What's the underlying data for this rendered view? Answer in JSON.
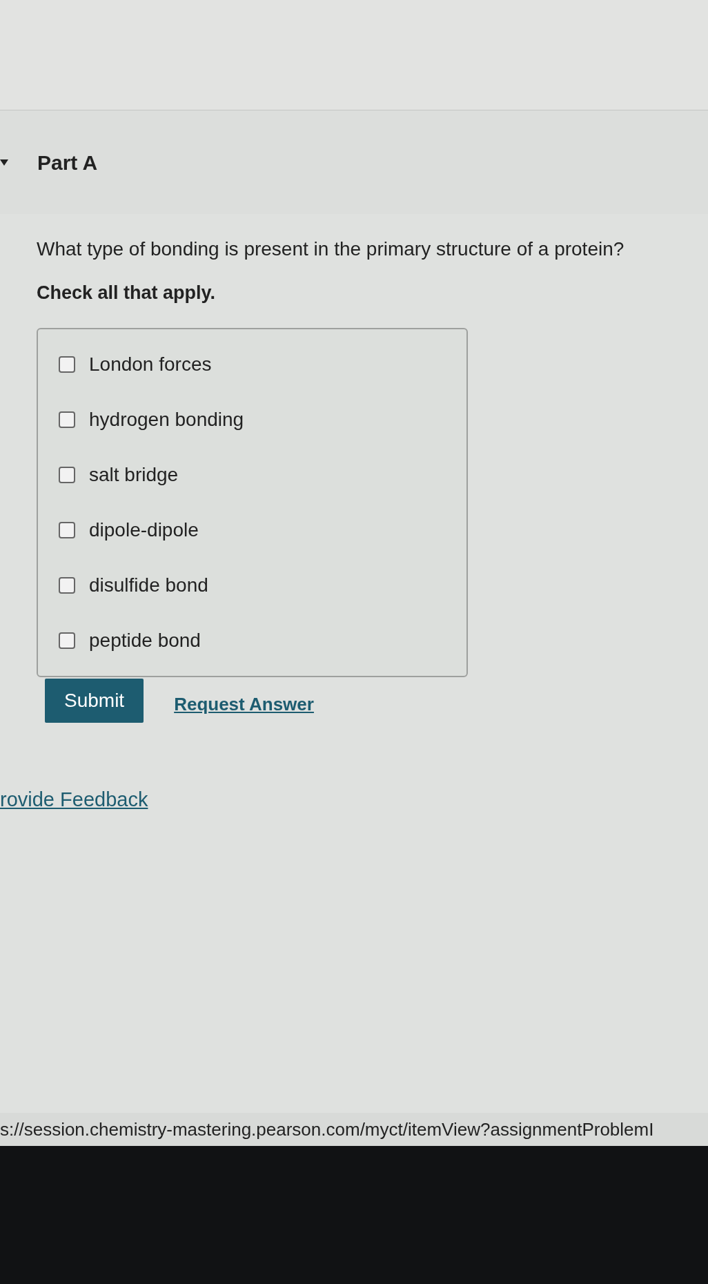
{
  "part": {
    "title": "Part A",
    "expanded": true
  },
  "question": "What type of bonding is present in the primary structure of a protein?",
  "instruction": "Check all that apply.",
  "options": [
    {
      "label": "London forces",
      "checked": false
    },
    {
      "label": "hydrogen bonding",
      "checked": false
    },
    {
      "label": "salt bridge",
      "checked": false
    },
    {
      "label": "dipole-dipole",
      "checked": false
    },
    {
      "label": "disulfide bond",
      "checked": false
    },
    {
      "label": "peptide bond",
      "checked": false
    }
  ],
  "submit": "Submit",
  "request_answer": "Request Answer",
  "feedback_link": "rovide Feedback",
  "status_url": "s://session.chemistry-mastering.pearson.com/myct/itemView?assignmentProblemI"
}
